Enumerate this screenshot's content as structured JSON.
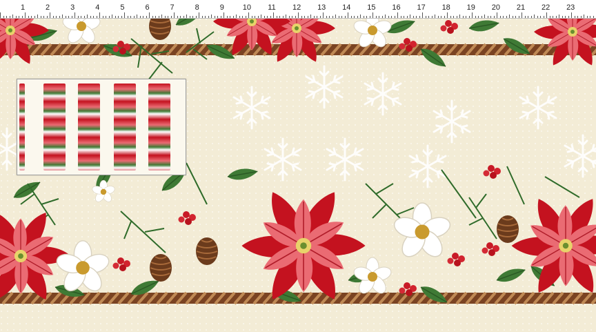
{
  "ruler": {
    "marks": [
      "1",
      "2",
      "3",
      "4",
      "5",
      "6",
      "7",
      "8",
      "9",
      "10",
      "11",
      "12",
      "13",
      "14",
      "15",
      "16",
      "17",
      "18",
      "19",
      "20",
      "21",
      "22",
      "23"
    ]
  },
  "colors": {
    "background": "#f3ecd6",
    "poinsettia_dark": "#c4121f",
    "poinsettia_light": "#ea6b73",
    "leaf_green": "#3f7a35",
    "rope_brown": "#7a4322",
    "snowflake": "#ffffff"
  },
  "thumbnail": {
    "strip_count": 5
  }
}
